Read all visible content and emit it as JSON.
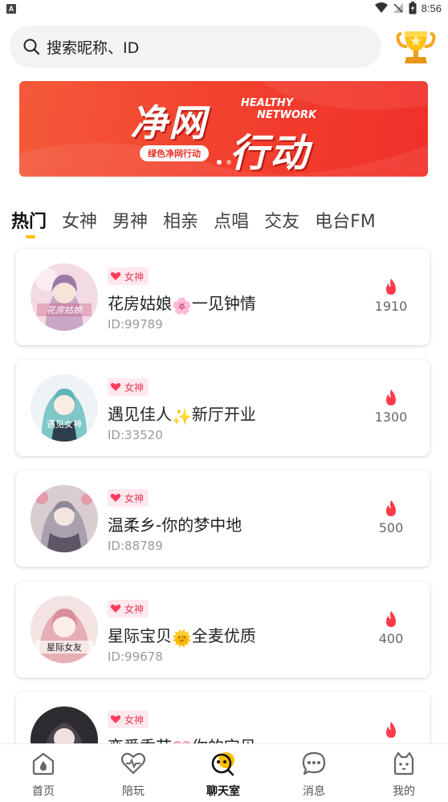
{
  "status_bar": {
    "left_icon": "A",
    "time": "8:56",
    "icons": [
      "wifi-icon",
      "no-signal-icon",
      "battery-icon"
    ]
  },
  "search": {
    "placeholder": "搜索昵称、ID"
  },
  "banner": {
    "title_line1": "净网",
    "title_line2": "行动",
    "english_line1": "HEALTHY",
    "english_line2": "NETWORK",
    "tag": "绿色净网行动"
  },
  "tabs": [
    "热门",
    "女神",
    "男神",
    "相亲",
    "点唱",
    "交友",
    "电台FM"
  ],
  "active_tab": "热门",
  "rooms": [
    {
      "badge": "女神",
      "name_before": "花房姑娘",
      "emoji": "🌸",
      "name_after": "一见钟情",
      "id": "ID:99789",
      "heat": "1910",
      "avatar_text": "花房姑娘"
    },
    {
      "badge": "女神",
      "name_before": "遇见佳人",
      "emoji": "✨",
      "name_after": "新厅开业",
      "id": "ID:33520",
      "heat": "1300",
      "avatar_text": "遇见女神"
    },
    {
      "badge": "女神",
      "name_before": "温柔乡-你的梦中地",
      "emoji": "",
      "name_after": "",
      "id": "ID:88789",
      "heat": "500",
      "avatar_text": ""
    },
    {
      "badge": "女神",
      "name_before": "星际宝贝",
      "emoji": "🌞",
      "name_after": "全麦优质",
      "id": "ID:99678",
      "heat": "400",
      "avatar_text": "星际女友"
    },
    {
      "badge": "女神",
      "name_before": "恋爱季节",
      "emoji": "💗",
      "name_after": "你的宝贝",
      "id": "",
      "heat": "",
      "avatar_text": ""
    }
  ],
  "bottom_nav": [
    {
      "label": "首页",
      "icon": "home-drop-icon"
    },
    {
      "label": "陪玩",
      "icon": "heart-pulse-icon"
    },
    {
      "label": "聊天室",
      "icon": "chat-face-icon"
    },
    {
      "label": "消息",
      "icon": "message-bubble-icon"
    },
    {
      "label": "我的",
      "icon": "profile-cat-icon"
    }
  ],
  "colors": {
    "accent": "#ffbf00",
    "banner_red": "#f2432f",
    "badge_pink": "#e33c57",
    "heat_red": "#ff3b4a"
  }
}
